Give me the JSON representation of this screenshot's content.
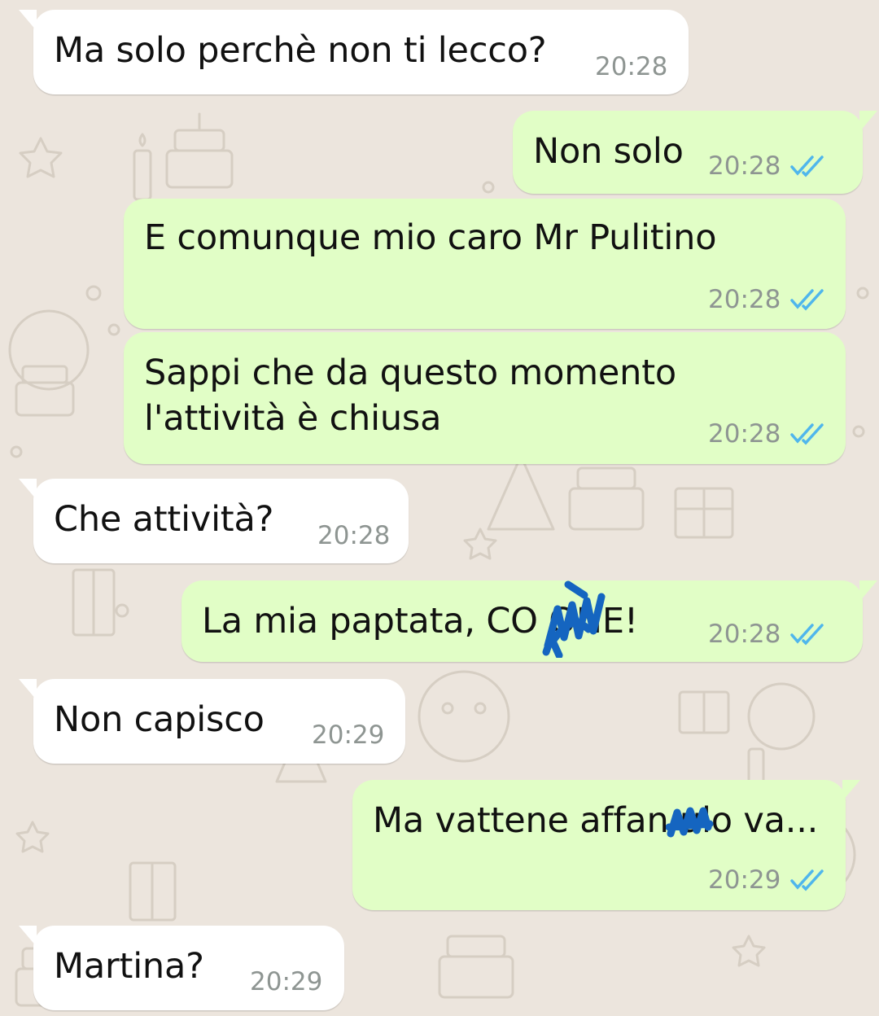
{
  "colors": {
    "background": "#ece5dd",
    "incoming_bubble": "#ffffff",
    "outgoing_bubble": "#e1fec6",
    "timestamp": "#8e9592",
    "read_ticks": "#4fb6ec",
    "censor_ink": "#1565c0"
  },
  "icons": {
    "read_receipt": "double-check-icon",
    "censor_mark": "scribble"
  },
  "messages": [
    {
      "direction": "incoming",
      "text": "Ma solo perchè non ti lecco?",
      "time": "20:28"
    },
    {
      "direction": "outgoing",
      "text": "Non solo",
      "time": "20:28",
      "status": "read"
    },
    {
      "direction": "outgoing",
      "text": "E comunque mio caro Mr Pulitino",
      "time": "20:28",
      "status": "read"
    },
    {
      "direction": "outgoing",
      "text_line1": "Sappi che da questo momento",
      "text_line2": "l'attività è chiusa",
      "time": "20:28",
      "status": "read"
    },
    {
      "direction": "incoming",
      "text": "Che attività?",
      "time": "20:28"
    },
    {
      "direction": "outgoing",
      "text": "La mia paptata, CO   ONE!",
      "time": "20:28",
      "status": "read",
      "censored": true
    },
    {
      "direction": "incoming",
      "text": "Non capisco",
      "time": "20:29"
    },
    {
      "direction": "outgoing",
      "text": "Ma vattene affan  ulo va...",
      "time": "20:29",
      "status": "read",
      "censored": true
    },
    {
      "direction": "incoming",
      "text": "Martina?",
      "time": "20:29"
    }
  ]
}
